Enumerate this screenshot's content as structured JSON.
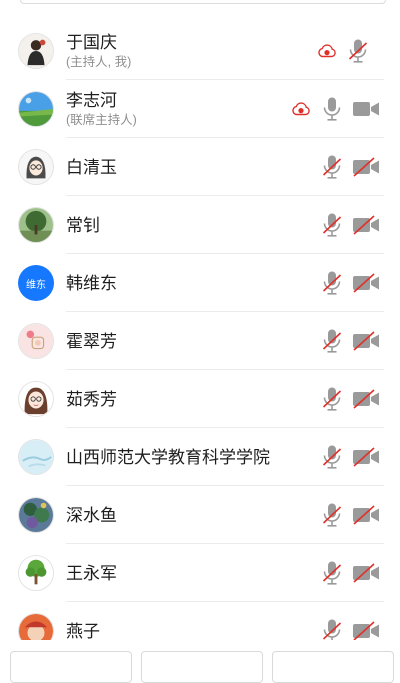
{
  "colors": {
    "record_red": "#e0302a",
    "icon_gray": "#9a9a9a",
    "strike_red": "#e0302a",
    "divider": "#ececec",
    "avatar_blue": "#1677ff"
  },
  "participants": [
    {
      "name": "于国庆",
      "role": "(主持人, 我)",
      "avatar": "cartoon-person-avatar",
      "recording": true,
      "mic": "muted",
      "camera": "none"
    },
    {
      "name": "李志河",
      "role": "(联席主持人)",
      "avatar": "landscape-avatar",
      "recording": true,
      "mic": "on",
      "camera": "on"
    },
    {
      "name": "白清玉",
      "role": "",
      "avatar": "girl-with-glasses-avatar",
      "recording": false,
      "mic": "muted",
      "camera": "off"
    },
    {
      "name": "常钊",
      "role": "",
      "avatar": "tree-photo-avatar",
      "recording": false,
      "mic": "muted",
      "camera": "off"
    },
    {
      "name": "韩维东",
      "role": "",
      "avatar": "initials-avatar",
      "avatar_text": "维东",
      "recording": false,
      "mic": "muted",
      "camera": "off"
    },
    {
      "name": "霍翠芳",
      "role": "",
      "avatar": "pink-cartoon-avatar",
      "recording": false,
      "mic": "muted",
      "camera": "off"
    },
    {
      "name": "茹秀芳",
      "role": "",
      "avatar": "cartoon-girl-avatar",
      "recording": false,
      "mic": "muted",
      "camera": "off"
    },
    {
      "name": "山西师范大学教育科学学院",
      "role": "",
      "avatar": "light-blue-avatar",
      "recording": false,
      "mic": "muted",
      "camera": "off"
    },
    {
      "name": "深水鱼",
      "role": "",
      "avatar": "painting-avatar",
      "recording": false,
      "mic": "muted",
      "camera": "off"
    },
    {
      "name": "王永军",
      "role": "",
      "avatar": "green-tree-avatar",
      "recording": false,
      "mic": "muted",
      "camera": "off"
    },
    {
      "name": "燕子",
      "role": "",
      "avatar": "red-orange-avatar",
      "recording": false,
      "mic": "muted",
      "camera": "off"
    }
  ]
}
